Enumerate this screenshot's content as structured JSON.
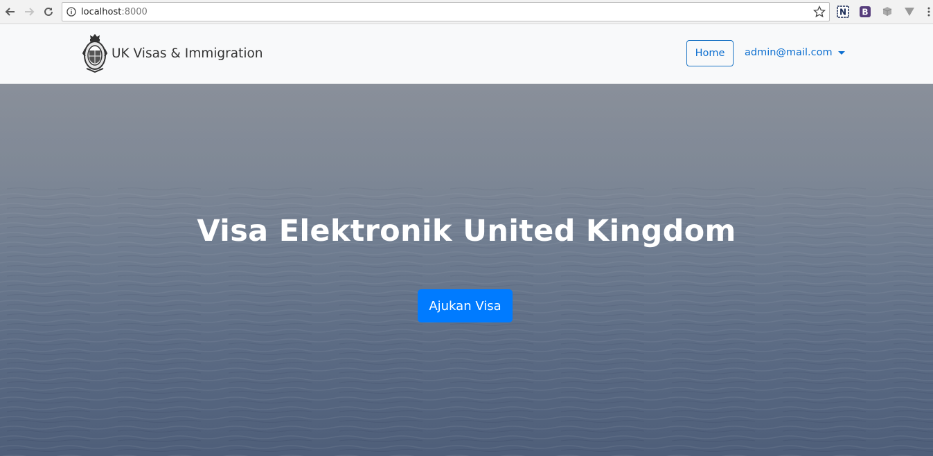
{
  "browser": {
    "url_host": "localhost",
    "url_port": ":8000",
    "extensions": [
      "N",
      "B"
    ]
  },
  "navbar": {
    "brand_text": "UK Visas & Immigration",
    "home_label": "Home",
    "user_email": "admin@mail.com"
  },
  "hero": {
    "title": "Visa Elektronik United Kingdom",
    "cta_label": "Ajukan Visa"
  },
  "colors": {
    "accent": "#007bff",
    "navbar_bg": "#f8f9fa",
    "link": "#0d6fd0"
  },
  "icons": [
    "back-arrow-icon",
    "forward-arrow-icon",
    "reload-icon",
    "info-icon",
    "star-icon",
    "menu-dots-icon",
    "royal-crest-icon",
    "dropdown-caret-icon"
  ]
}
